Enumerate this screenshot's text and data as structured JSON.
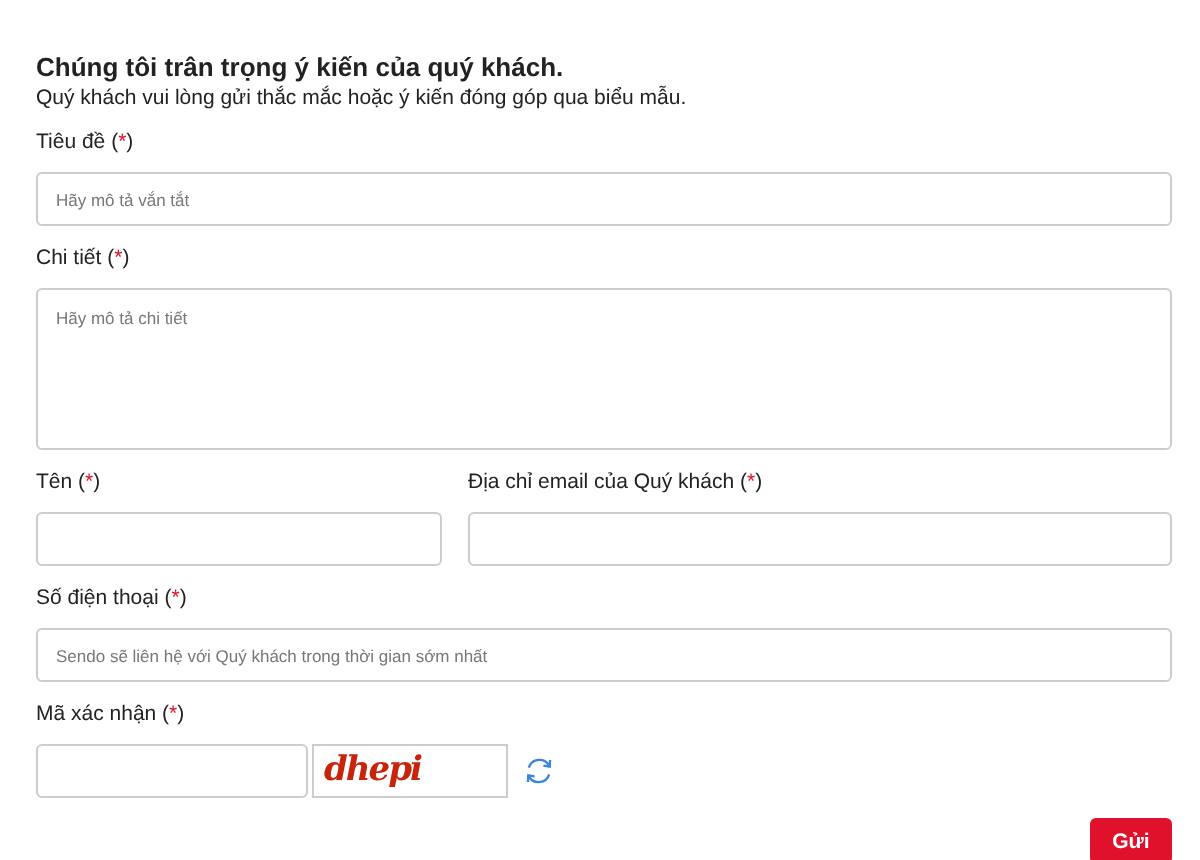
{
  "heading": "Chúng tôi trân trọng ý kiến của quý khách.",
  "intro": "Quý khách vui lòng gửi thắc mắc hoặc ý kiến đóng góp qua biểu mẫu.",
  "rows": [
    {
      "fields": [
        {
          "kind": "input",
          "label": "Tiêu đề",
          "required_mark": "(*)",
          "placeholder": "Hãy mô tả vắn tắt"
        }
      ]
    },
    {
      "fields": [
        {
          "kind": "textarea",
          "label": "Chi tiết",
          "required_mark": "(*)",
          "placeholder": "Hãy mô tả chi tiết"
        }
      ]
    },
    {
      "fields": [
        {
          "kind": "input",
          "label": "Tên",
          "required_mark": "(*)"
        },
        {
          "kind": "input",
          "label": "Địa chỉ email của Quý khách",
          "required_mark": "(*)"
        }
      ]
    },
    {
      "fields": [
        {
          "kind": "input",
          "label": "Số điện thoại",
          "required_mark": "(*)",
          "placeholder": "Sendo sẽ liên hệ với Quý khách trong thời gian sớm nhất"
        }
      ]
    },
    {
      "fields": [
        {
          "kind": "captcha",
          "label": "Mã xác nhận",
          "required_mark": "(*)",
          "captcha_text": "dhepi"
        }
      ]
    }
  ],
  "submit": "Gửi"
}
